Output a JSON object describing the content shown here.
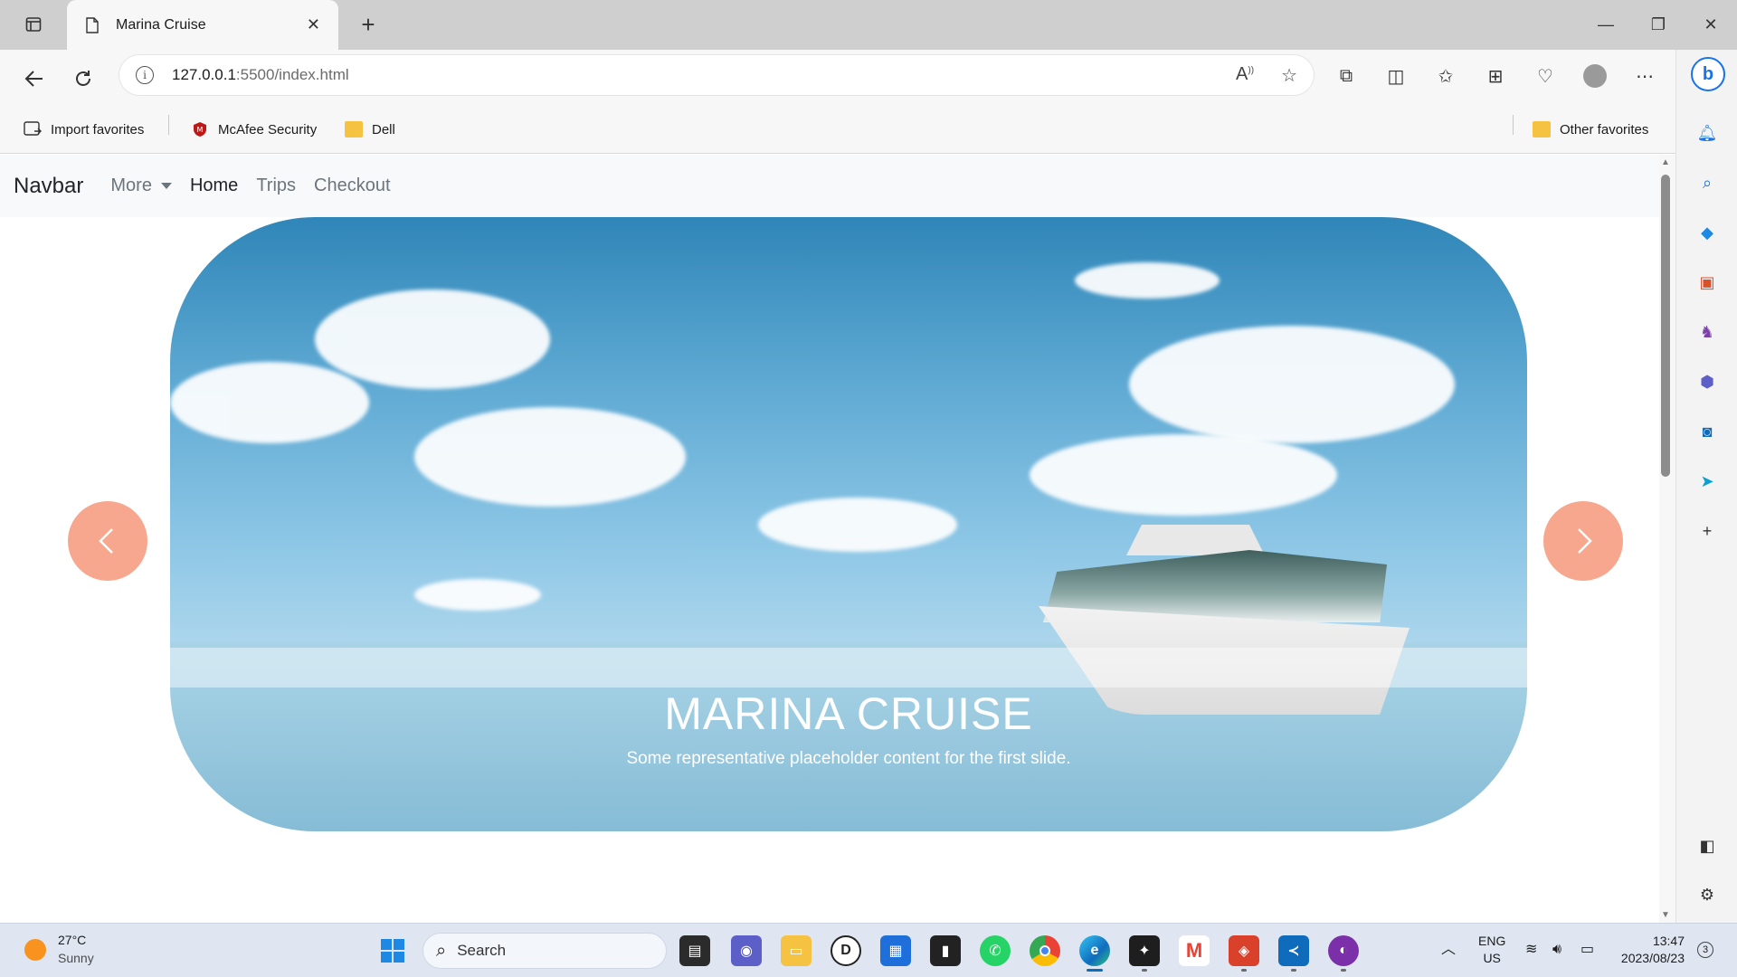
{
  "browser": {
    "tab_title": "Marina Cruise",
    "tab_close": "✕",
    "new_tab": "+",
    "url_host": "127.0.0.1",
    "url_path": ":5500/index.html",
    "window": {
      "minimize": "—",
      "restore": "❐",
      "close": "✕"
    }
  },
  "favorites": {
    "items": [
      {
        "label": "Import favorites"
      },
      {
        "label": "McAfee Security"
      },
      {
        "label": "Dell"
      }
    ],
    "other": "Other favorites"
  },
  "page": {
    "navbar": {
      "brand": "Navbar",
      "links": [
        {
          "label": "More"
        },
        {
          "label": "Home"
        },
        {
          "label": "Trips"
        },
        {
          "label": "Checkout"
        }
      ]
    },
    "carousel": {
      "title": "MARINA CRUISE",
      "text": "Some representative placeholder content for the first slide.",
      "control_color": "#f7a78e"
    }
  },
  "taskbar": {
    "weather_temp": "27°C",
    "weather_desc": "Sunny",
    "search_label": "Search",
    "lang_top": "ENG",
    "lang_bottom": "US",
    "time": "13:47",
    "date": "2023/08/23",
    "notifications": "3"
  }
}
